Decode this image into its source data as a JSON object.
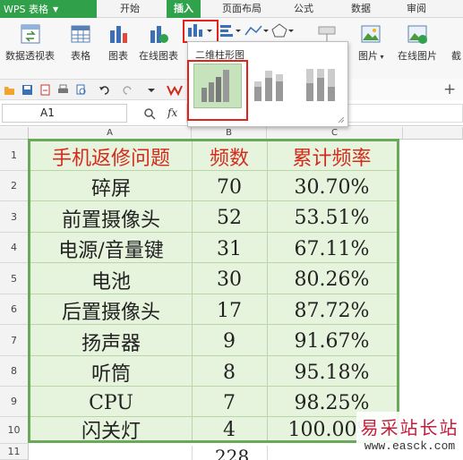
{
  "app": {
    "menu_button": "WPS 表格"
  },
  "menu_tabs": [
    "开始",
    "插入",
    "页面布局",
    "公式",
    "数据",
    "审阅"
  ],
  "active_tab": "插入",
  "ribbon": {
    "pivot_table": "数据透视表",
    "table": "表格",
    "chart": "图表",
    "online_chart": "在线图表",
    "picture": "图片",
    "online_picture": "在线图片",
    "screenshot": "截"
  },
  "dropdown": {
    "title": "二维柱形图",
    "options": [
      "簇状柱形图",
      "堆积柱形图",
      "百分比堆积柱形图"
    ],
    "selected": "簇状柱形图"
  },
  "formula_bar": {
    "name_box": "A1",
    "fx": "fx"
  },
  "grid": {
    "columns": [
      "A",
      "B",
      "C"
    ],
    "rows": [
      "1",
      "2",
      "3",
      "4",
      "5",
      "6",
      "7",
      "8",
      "9",
      "10",
      "11"
    ],
    "headers": [
      "手机返修问题",
      "频数",
      "累计频率"
    ],
    "data": [
      [
        "碎屏",
        "70",
        "30.70%"
      ],
      [
        "前置摄像头",
        "52",
        "53.51%"
      ],
      [
        "电源/音量键",
        "31",
        "67.11%"
      ],
      [
        "电池",
        "30",
        "80.26%"
      ],
      [
        "后置摄像头",
        "17",
        "87.72%"
      ],
      [
        "扬声器",
        "9",
        "91.67%"
      ],
      [
        "听筒",
        "8",
        "95.18%"
      ],
      [
        "CPU",
        "7",
        "98.25%"
      ],
      [
        "闪关灯",
        "4",
        "100.00%"
      ]
    ],
    "partial_row11": "228"
  },
  "watermark": {
    "line1": "易采站长站",
    "line2": "www.easck.com"
  },
  "colors": {
    "accent": "#2fa24b",
    "header_text": "#d42b1c",
    "table_fill": "#e7f4dd",
    "highlight": "#e2231a"
  }
}
